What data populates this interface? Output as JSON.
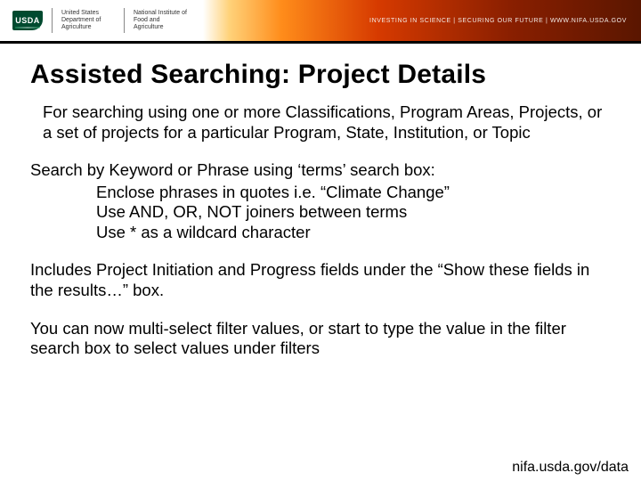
{
  "header": {
    "usda_abbrev": "USDA",
    "org1": "United States Department of Agriculture",
    "org2": "National Institute of Food and Agriculture",
    "tagline": "INVESTING IN SCIENCE | SECURING OUR FUTURE | WWW.NIFA.USDA.GOV"
  },
  "title": "Assisted Searching: Project Details",
  "para1": "For searching using one or more Classifications, Program Areas, Projects, or a set of projects for a particular Program, State, Institution, or Topic",
  "search_block": {
    "lead": "Search by Keyword or Phrase using ‘terms’ search box:",
    "line1": "Enclose phrases in quotes i.e. “Climate Change”",
    "line2": "Use AND, OR, NOT joiners between terms",
    "line3": "Use * as a wildcard character"
  },
  "para2": "Includes Project Initiation and Progress fields under the “Show these fields in the results…” box.",
  "para3": "You can now multi-select filter values, or start to type the value in the filter search box to select values under filters",
  "footer_url": "nifa.usda.gov/data"
}
